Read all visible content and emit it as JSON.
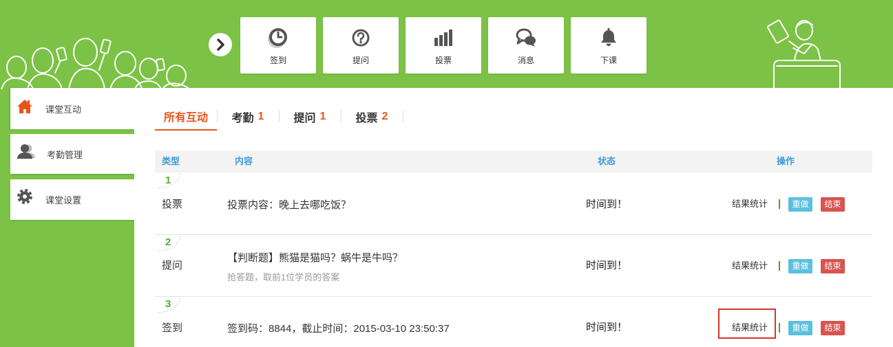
{
  "colors": {
    "brand_green": "#7cc246",
    "accent_orange": "#e8541b",
    "header_blue": "#3f9bd6",
    "index_green": "#4fae30",
    "redo_blue": "#5bc0de",
    "end_red": "#d9534f",
    "highlight_red": "#d8322a"
  },
  "toolbar": {
    "expand_icon": "chevron-right-icon",
    "items": [
      {
        "label": "签到",
        "icon": "clock-icon"
      },
      {
        "label": "提问",
        "icon": "question-icon"
      },
      {
        "label": "投票",
        "icon": "bar-chart-icon"
      },
      {
        "label": "消息",
        "icon": "chat-icon"
      },
      {
        "label": "下课",
        "icon": "bell-icon"
      }
    ]
  },
  "sidebar": {
    "items": [
      {
        "label": "课堂互动",
        "icon": "home-icon",
        "active": true
      },
      {
        "label": "考勤管理",
        "icon": "user-icon",
        "active": false
      },
      {
        "label": "课堂设置",
        "icon": "gear-icon",
        "active": false
      }
    ]
  },
  "tabs": [
    {
      "label": "所有互动",
      "active": true
    },
    {
      "label": "考勤",
      "count": "1",
      "active": false
    },
    {
      "label": "提问",
      "count": "1",
      "active": false
    },
    {
      "label": "投票",
      "count": "2",
      "active": false
    }
  ],
  "table": {
    "headers": {
      "type": "类型",
      "content": "内容",
      "status": "状态",
      "actions": "操作"
    },
    "rows": [
      {
        "index": "1",
        "type": "投票",
        "content": "投票内容：晚上去哪吃饭？",
        "status": "时间到！",
        "stats_label": "结果统计",
        "redo_label": "重做",
        "end_label": "结束"
      },
      {
        "index": "2",
        "type": "提问",
        "content": "【判断题】熊猫是猫吗？蜗牛是牛吗？",
        "subtext": "抢答题，取前1位学员的答案",
        "status": "时间到！",
        "stats_label": "结果统计",
        "redo_label": "重做",
        "end_label": "结束"
      },
      {
        "index": "3",
        "type": "签到",
        "content": "签到码：8844，截止时间：2015-03-10 23:50:37",
        "status": "时间到！",
        "stats_label": "结果统计",
        "redo_label": "重做",
        "end_label": "结束",
        "highlighted": true
      }
    ]
  }
}
